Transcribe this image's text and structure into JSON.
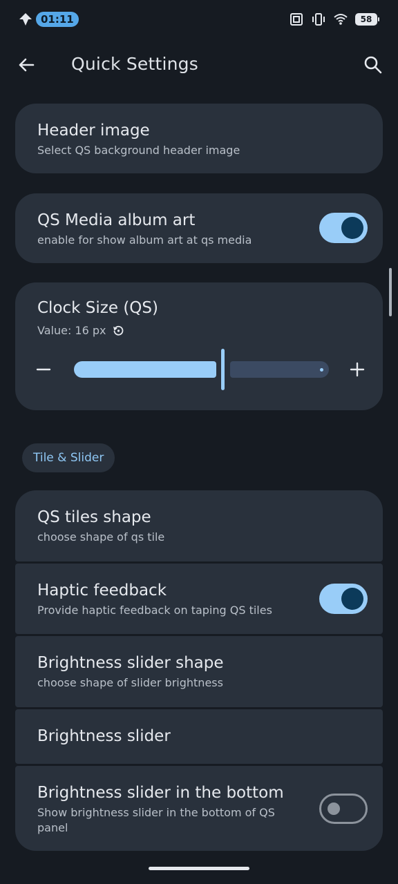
{
  "status_bar": {
    "time": "01:11",
    "battery": "58",
    "icons": [
      "app-logo-icon",
      "nfc-icon",
      "vibrate-icon",
      "wifi-icon",
      "battery-icon"
    ]
  },
  "header": {
    "title": "Quick Settings",
    "back_icon": "arrow-left-icon",
    "search_icon": "search-icon"
  },
  "cards": {
    "header_image": {
      "title": "Header image",
      "subtitle": "Select QS background header image"
    },
    "media_art": {
      "title": "QS Media album art",
      "subtitle": "enable for show album art at qs media",
      "enabled": true
    },
    "clock_size": {
      "title": "Clock Size (QS)",
      "value_label": "Value: 16 px",
      "reset_icon": "history-icon",
      "value": 16
    }
  },
  "section": {
    "label": "Tile & Slider"
  },
  "tiles_group": {
    "tiles_shape": {
      "title": "QS tiles shape",
      "subtitle": "choose shape of qs tile"
    },
    "haptic": {
      "title": "Haptic feedback",
      "subtitle": "Provide haptic feedback on taping QS tiles",
      "enabled": true
    },
    "slider_shape": {
      "title": "Brightness slider shape",
      "subtitle": "choose shape of slider brightness"
    },
    "slider": {
      "title": "Brightness slider"
    },
    "slider_bottom": {
      "title": "Brightness slider in the bottom",
      "subtitle_line1": "Show brightness slider in the bottom of QS",
      "subtitle_line2": "panel",
      "enabled": false
    }
  },
  "colors": {
    "background": "#161b22",
    "card": "#29313c",
    "accent": "#99cdf8",
    "accent_dark": "#0c3a5a"
  }
}
